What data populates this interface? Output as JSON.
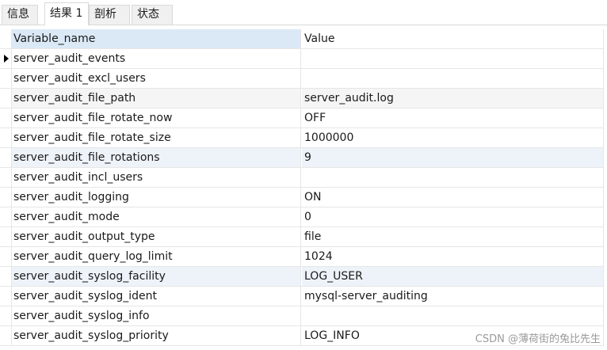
{
  "tabs": [
    {
      "label": "信息"
    },
    {
      "label": "结果 1"
    },
    {
      "label": "剖析"
    },
    {
      "label": "状态"
    }
  ],
  "table": {
    "columns": [
      "Variable_name",
      "Value"
    ],
    "rows": [
      {
        "name": "server_audit_events",
        "value": ""
      },
      {
        "name": "server_audit_excl_users",
        "value": ""
      },
      {
        "name": "server_audit_file_path",
        "value": "server_audit.log"
      },
      {
        "name": "server_audit_file_rotate_now",
        "value": "OFF"
      },
      {
        "name": "server_audit_file_rotate_size",
        "value": "1000000"
      },
      {
        "name": "server_audit_file_rotations",
        "value": "9"
      },
      {
        "name": "server_audit_incl_users",
        "value": ""
      },
      {
        "name": "server_audit_logging",
        "value": "ON"
      },
      {
        "name": "server_audit_mode",
        "value": "0"
      },
      {
        "name": "server_audit_output_type",
        "value": "file"
      },
      {
        "name": "server_audit_query_log_limit",
        "value": "1024"
      },
      {
        "name": "server_audit_syslog_facility",
        "value": "LOG_USER"
      },
      {
        "name": "server_audit_syslog_ident",
        "value": "mysql-server_auditing"
      },
      {
        "name": "server_audit_syslog_info",
        "value": ""
      },
      {
        "name": "server_audit_syslog_priority",
        "value": "LOG_INFO"
      }
    ]
  },
  "watermark": "CSDN @薄荷街的兔比先生"
}
